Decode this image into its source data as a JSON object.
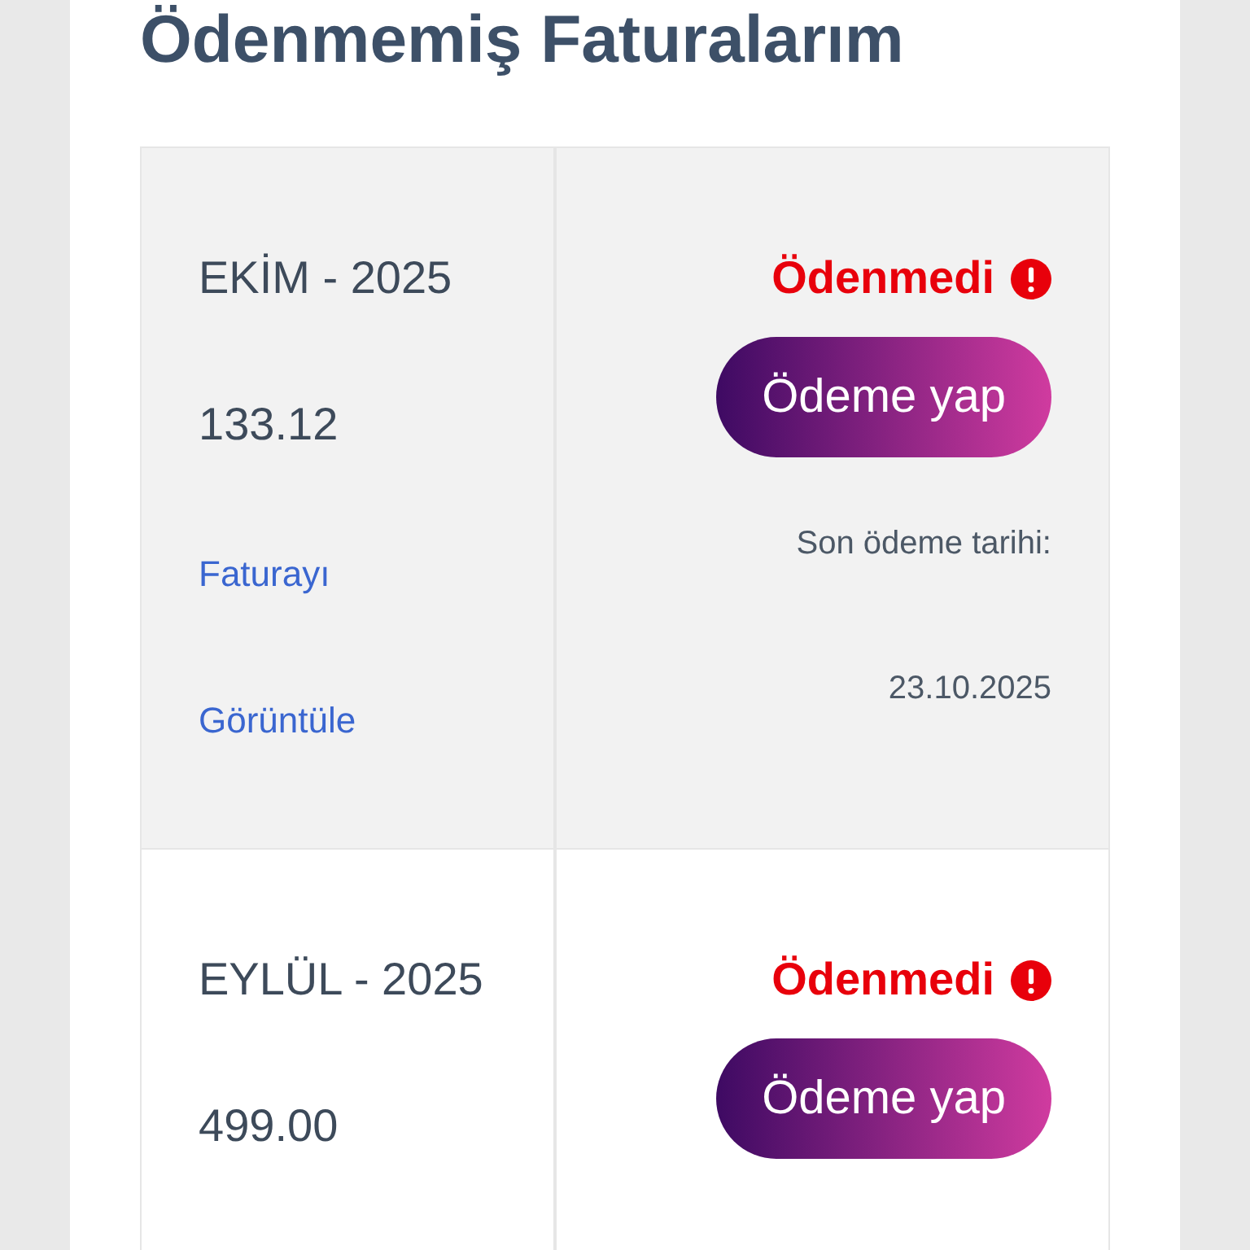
{
  "title": "Ödenmemiş Faturalarım",
  "invoices": [
    {
      "period": "EKİM - 2025",
      "amount": "133.12",
      "status": {
        "label": "Ödenmedi",
        "paid": false
      },
      "pay_button": "Ödeme yap",
      "view_link": "Faturayı Görüntüle",
      "due_label": "Son ödeme tarihi:",
      "due_date": "23.10.2025"
    },
    {
      "period": "EYLÜL - 2025",
      "amount": "499.00",
      "status": {
        "label": "Ödenmedi",
        "paid": false
      },
      "pay_button": "Ödeme yap"
    }
  ]
}
